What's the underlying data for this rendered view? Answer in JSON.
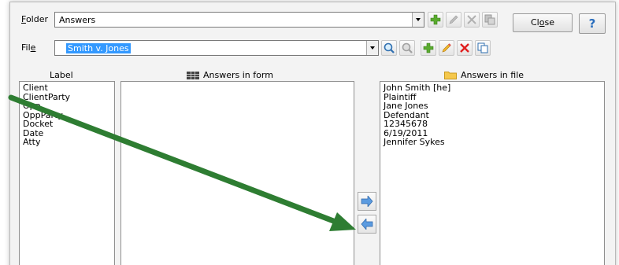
{
  "folder": {
    "label_pre": "",
    "label_key": "F",
    "label_post": "older",
    "value": "Answers"
  },
  "file": {
    "label_pre": "Fil",
    "label_key": "e",
    "label_post": "",
    "value": "Smith v. Jones"
  },
  "close_button": {
    "label_pre": "Cl",
    "label_key": "o",
    "label_post": "se"
  },
  "help_button": {
    "label": "?"
  },
  "columns": {
    "label_header": "Label",
    "form_header": "Answers in form",
    "file_header": "Answers in file"
  },
  "labels": [
    "Client",
    "ClientParty",
    "Opp",
    "OppParty",
    "Docket",
    "Date",
    "Atty"
  ],
  "answers_in_file": [
    "John Smith [he]",
    "Plaintiff",
    "Jane Jones",
    "Defendant",
    "12345678",
    "6/19/2011",
    "Jennifer Sykes"
  ],
  "colors": {
    "arrow": "#2e7d32",
    "selection": "#3399ff",
    "help": "#2a6ebd"
  }
}
